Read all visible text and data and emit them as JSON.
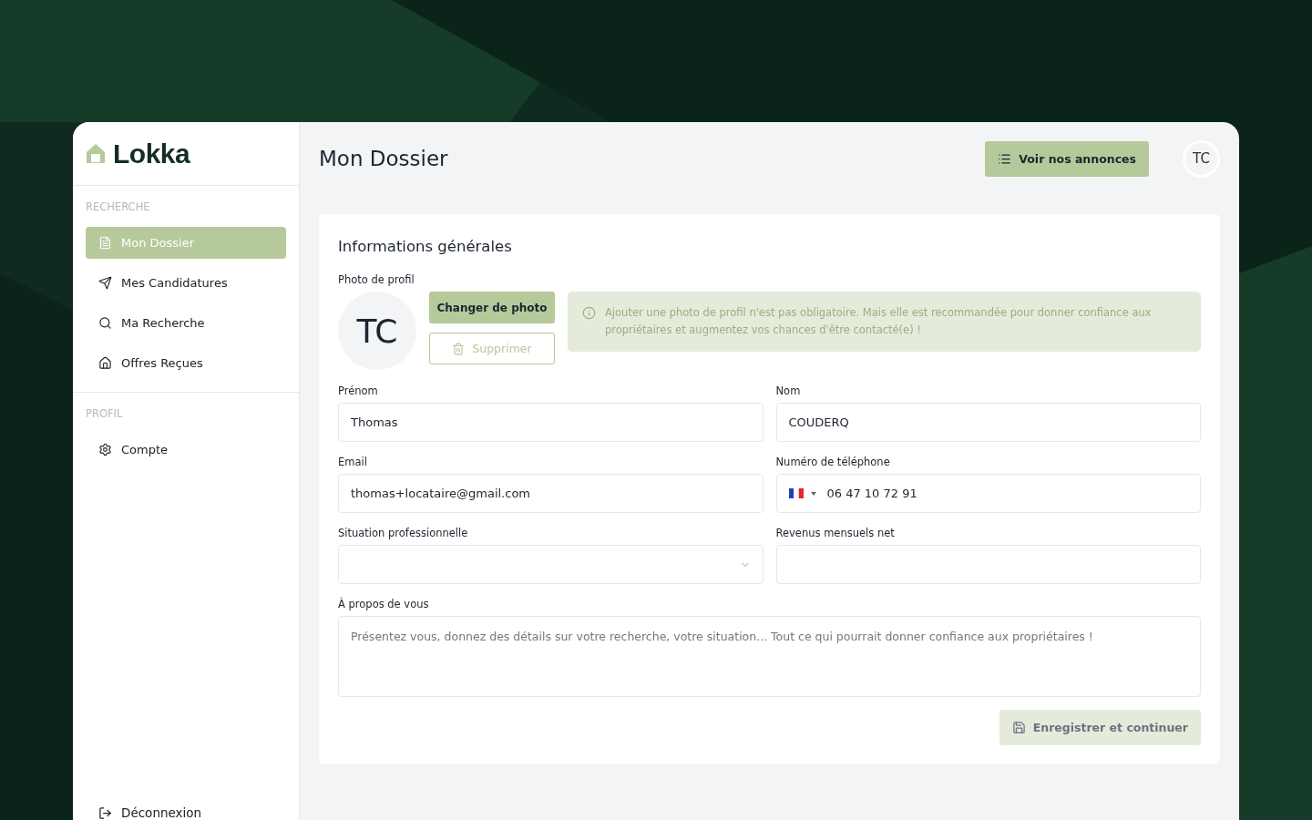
{
  "sidebar": {
    "logo": "Lokka",
    "sections": [
      {
        "title": "RECHERCHE",
        "items": [
          {
            "label": "Mon Dossier",
            "selected": true
          },
          {
            "label": "Mes Candidatures",
            "selected": false
          },
          {
            "label": "Ma Recherche",
            "selected": false
          },
          {
            "label": "Offres Reçues",
            "selected": false
          }
        ]
      },
      {
        "title": "PROFIL",
        "items": [
          {
            "label": "Compte",
            "selected": false
          }
        ]
      }
    ],
    "logout": "Déconnexion"
  },
  "header": {
    "title": "Mon Dossier",
    "button": "Voir nos annonces",
    "avatar": "TC"
  },
  "card": {
    "title": "Informations générales",
    "photo": {
      "label": "Photo de profil",
      "initials": "TC",
      "change_button": "Changer de photo",
      "delete_button": "Supprimer",
      "info": "Ajouter une photo de profil n'est pas obligatoire. Mais elle est recommandée pour donner confiance aux propriétaires et augmentez vos chances d'être contacté(e) !"
    },
    "fields": [
      {
        "kind": "text",
        "label": "Prénom",
        "value": "Thomas"
      },
      {
        "kind": "text",
        "label": "Nom",
        "value": "COUDERQ"
      },
      {
        "kind": "text",
        "label": "Email",
        "value": "thomas+locataire@gmail.com"
      },
      {
        "kind": "phone",
        "label": "Numéro de téléphone",
        "value": "06 47 10 72 91"
      },
      {
        "kind": "select",
        "label": "Situation professionnelle"
      },
      {
        "kind": "text",
        "label": "Revenus mensuels net"
      },
      {
        "kind": "textarea",
        "label": "À propos de vous",
        "placeholder": "Présentez vous, donnez des détails sur votre recherche, votre situation... Tout ce qui pourrait donner confiance aux propriétaires !"
      }
    ],
    "save_button": {
      "label": "Enregistrer et continuer",
      "disabled": true
    }
  }
}
